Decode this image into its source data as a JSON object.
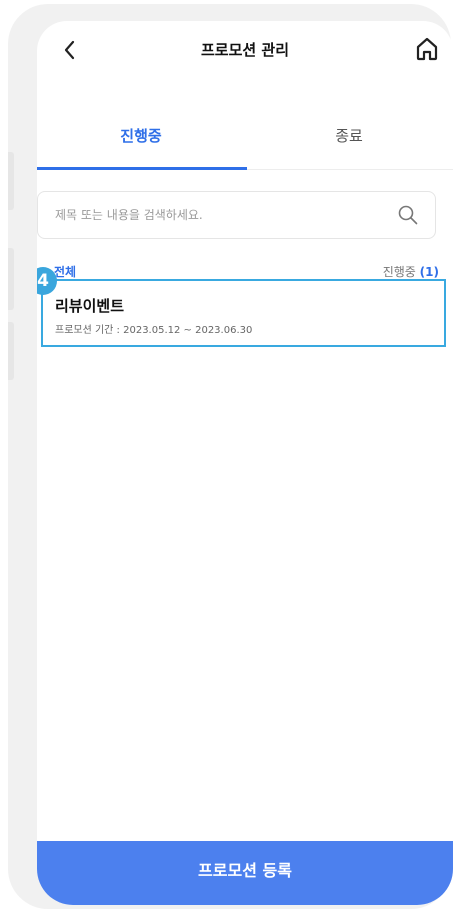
{
  "header": {
    "title": "프로모션 관리",
    "back_icon": "chevron-left-icon",
    "home_icon": "home-icon"
  },
  "tabs": [
    {
      "label": "진행중",
      "active": true
    },
    {
      "label": "종료",
      "active": false
    }
  ],
  "search": {
    "placeholder": "제목 또는 내용을 검색하세요.",
    "icon": "search-icon"
  },
  "filter": {
    "all_label": "전체",
    "status_label": "진행중",
    "count": "(1)"
  },
  "promotions": [
    {
      "badge": "4",
      "title": "리뷰이벤트",
      "period": "프로모션 기간 : 2023.05.12 ~ 2023.06.30"
    }
  ],
  "footer": {
    "register_label": "프로모션 등록"
  },
  "colors": {
    "accent": "#2f6fe8",
    "button": "#4c80ee",
    "highlight_border": "#39a9e0",
    "badge": "#3aa6dd"
  }
}
